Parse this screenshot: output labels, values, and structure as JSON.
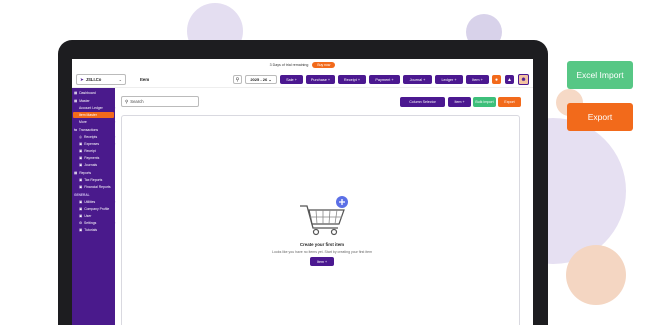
{
  "colors": {
    "brand_purple": "#4b1890",
    "accent_orange": "#f26a1b",
    "green": "#3dbf7a",
    "excel_green": "#57c785"
  },
  "trial": {
    "text": "3 Days of trial remaining",
    "buy_label": "Buy now"
  },
  "topbar": {
    "company": "JSLI.Co",
    "page_title": "Item",
    "year": "2025 - 26",
    "quick_buttons": [
      "Sale +",
      "Purchase +",
      "Receipt +",
      "Payment +",
      "Journal +",
      "Ledger +",
      "Item +"
    ]
  },
  "sidebar": {
    "dashboard": "Dashboard",
    "master": "Master",
    "account_ledger": "Account Ledger",
    "item_master": "Item Master",
    "more": "More",
    "transactions": "Transactions",
    "receipts": "Receipts",
    "expenses": "Expenses",
    "receipt": "Receipt",
    "payments": "Payments",
    "journals": "Journals",
    "reports": "Reports",
    "tax_reports": "Tax Reports",
    "financial_reports": "Financial Reports",
    "general_label": "GENERAL",
    "utilities": "Utilities",
    "company_profile": "Company Profile",
    "user": "User",
    "settings": "Settings",
    "tutorials": "Tutorials"
  },
  "main": {
    "search_placeholder": "Search",
    "column_selector": "Column Selector",
    "item_add": "Item +",
    "bulk_import": "Bulk Import",
    "export_small": "Export",
    "empty_title": "Create your first item",
    "empty_subtitle": "Looks like you have no items yet. Start by creating your first item",
    "empty_button": "Item +"
  },
  "side_buttons": {
    "excel_import": "Excel Import",
    "export": "Export"
  }
}
